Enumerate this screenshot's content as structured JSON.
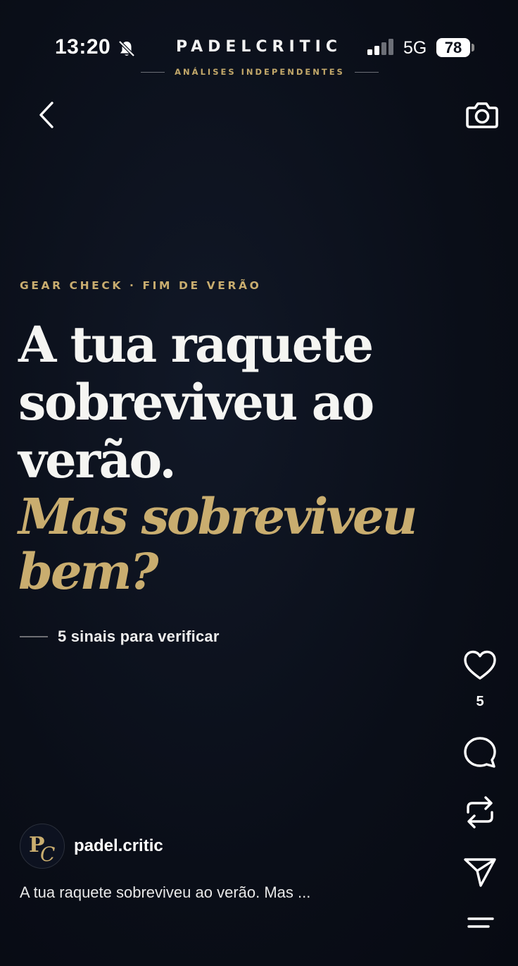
{
  "status_bar": {
    "time": "13:20",
    "network": "5G",
    "battery": "78",
    "icons": [
      "bell-slash-icon",
      "signal-icon"
    ]
  },
  "brand": {
    "name": "PADELCRITIC",
    "tagline": "ANÁLISES INDEPENDENTES"
  },
  "nav": {
    "back_icon": "chevron-left-icon",
    "camera_icon": "camera-icon"
  },
  "post": {
    "eyebrow": "GEAR CHECK · FIM DE VERÃO",
    "headline": "A tua raquete sobreviveu ao verão.",
    "headline_accent": "Mas sobreviveu bem?",
    "subline": "5 sinais para verificar"
  },
  "actions": {
    "like_count": "5",
    "icons": [
      "heart-icon",
      "comment-icon",
      "repost-icon",
      "send-icon",
      "menu-icon"
    ]
  },
  "author": {
    "avatar_monogram": "PC",
    "username": "padel.critic"
  },
  "caption": "A tua raquete sobreviveu ao verão. Mas ...",
  "colors": {
    "background": "#0b0f1a",
    "gold_accent": "#c9ad6f",
    "text": "#f5f5f2"
  }
}
